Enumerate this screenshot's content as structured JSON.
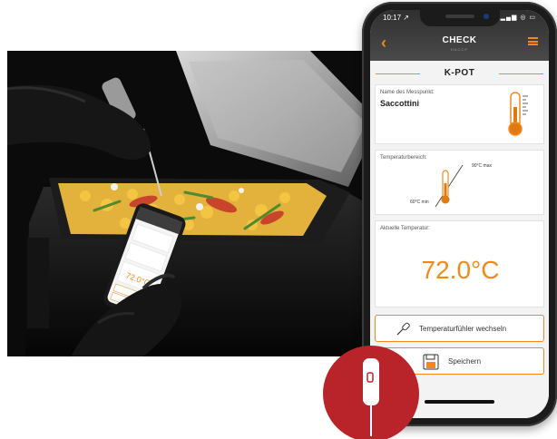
{
  "status_bar": {
    "time": "10:17 ↗",
    "icons": "▂▄▆ ◎ ▭"
  },
  "app_bar": {
    "title": "CHECK",
    "subtitle": "HACCP",
    "back_icon": "chevron-left-icon",
    "menu_icon": "hamburger-menu-icon"
  },
  "section": {
    "title": "K-POT"
  },
  "measure_point": {
    "label": "Name des Messpunkt:",
    "value": "Saccottini"
  },
  "temp_range": {
    "label": "Temperaturbereich:",
    "max": "90°C max",
    "min": "60°C min"
  },
  "current_temp": {
    "label": "Aktuelle Temperatur:",
    "value": "72.0°C"
  },
  "buttons": {
    "change_probe": "Temperaturfühler wechseln",
    "save": "Speichern"
  },
  "colors": {
    "accent": "#f08a1c",
    "badge": "#b8242a",
    "appbar": "#3a3a3a"
  },
  "small_phone": {
    "value": "72.0°C"
  }
}
